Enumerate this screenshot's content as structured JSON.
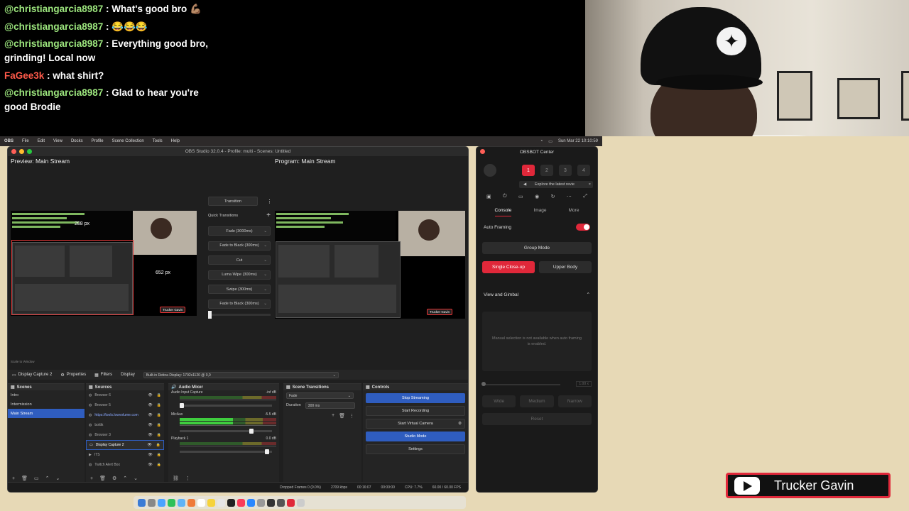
{
  "chat": {
    "lines": [
      {
        "user": "@christiangarcia8987",
        "sep": " : ",
        "msg": "What's good bro 💪🏽"
      },
      {
        "user": "@christiangarcia8987",
        "sep": " : ",
        "msg": "😂😂😂"
      },
      {
        "user": "@christiangarcia8987",
        "sep": " : ",
        "msg": "Everything good bro, grinding! Local now"
      },
      {
        "user": "FaGee3k",
        "sep": " : ",
        "msg": "what shirt?"
      },
      {
        "user": "@christiangarcia8987",
        "sep": " : ",
        "msg": "Glad to hear you're good Brodie"
      }
    ]
  },
  "menubar": {
    "items": [
      "OBS",
      "File",
      "Edit",
      "View",
      "Docks",
      "Profile",
      "Scene Collection",
      "Tools",
      "Help"
    ],
    "clock": "Sun Mar 22 10:10:59"
  },
  "obs": {
    "window_title": "OBS Studio 32.0.4 - Profile: multi - Scenes: Untitled",
    "preview_label": "Preview: Main Stream",
    "program_label": "Program: Main Stream",
    "preview_height_label": "288 px",
    "preview_width_label": "652 px",
    "transition_button": "Transition",
    "quick_transitions_label": "Quick Transitions",
    "quick_transitions": [
      "Fade (3000ms)",
      "Fade to Black (300ms)",
      "Cut",
      "Luma Wipe (300ms)",
      "Swipe (300ms)",
      "Fade to Black (300ms)"
    ],
    "scale_label": "Scale to Window",
    "source_bar": {
      "source_name": "Display Capture 2",
      "properties": "Properties",
      "filters": "Filters",
      "display_label": "Display",
      "display_value": "Built-in Retina Display: 1792x1120 @ 0,0"
    },
    "scenes": {
      "title": "Scenes",
      "items": [
        "Intro",
        "Intermission",
        "Main Stream"
      ],
      "selected": "Main Stream"
    },
    "sources": {
      "title": "Sources",
      "items": [
        "Browser 6",
        "Browser 5",
        "https://tools.lowvolume.com",
        "bottik",
        "Browser 3",
        "Display Capture 2",
        "ITS",
        "Twitch Alert Box"
      ],
      "selected": "Display Capture 2"
    },
    "audio_mixer": {
      "title": "Audio Mixer",
      "channels": [
        {
          "name": "Audio Input Capture",
          "db": "-inf dB",
          "level": 0
        },
        {
          "name": "MicAux",
          "db": "-5.5 dB",
          "level": 0.55
        },
        {
          "name": "Playback 1",
          "db": "0.0 dB",
          "level": 0
        }
      ]
    },
    "scene_transitions": {
      "title": "Scene Transitions",
      "transition": "Fade",
      "duration_label": "Duration",
      "duration_value": "300 ms"
    },
    "controls": {
      "title": "Controls",
      "stop_streaming": "Stop Streaming",
      "start_recording": "Start Recording",
      "start_virtual_camera": "Start Virtual Camera",
      "studio_mode": "Studio Mode",
      "settings": "Settings"
    },
    "status": {
      "dropped_frames": "Dropped Frames 0 (0.0%)",
      "bitrate": "2709 kbps",
      "stream_time": "00:16:07",
      "rec_time": "00:00:00",
      "cpu": "CPU: 7.7%",
      "fps": "60.00 / 60.00 FPS"
    }
  },
  "obsbot": {
    "title": "OBSBOT Center",
    "device_slots": [
      "1",
      "2",
      "3",
      "4"
    ],
    "active_slot": "1",
    "banner": "Explore the latest revie",
    "tabs": [
      "Console",
      "Image",
      "More"
    ],
    "active_tab": "Console",
    "auto_framing_label": "Auto Framing",
    "auto_framing_on": true,
    "group_mode": "Group Mode",
    "single_closeup": "Single Close-up",
    "upper_body": "Upper Body",
    "view_gimbal": "View and Gimbal",
    "gimbal_note": "Manual selection is not available when auto framing is enabled.",
    "zoom_value": "1.00 x",
    "wide": "Wide",
    "medium": "Medium",
    "narrow": "Narrow",
    "reset": "Reset"
  },
  "overlay": {
    "channel_name": "Trucker Gavin"
  },
  "colors": {
    "accent_blue": "#2f5dbf",
    "accent_red": "#e0283a",
    "chat_user_green": "#9ee87f",
    "chat_user_red": "#ff5a4a"
  }
}
